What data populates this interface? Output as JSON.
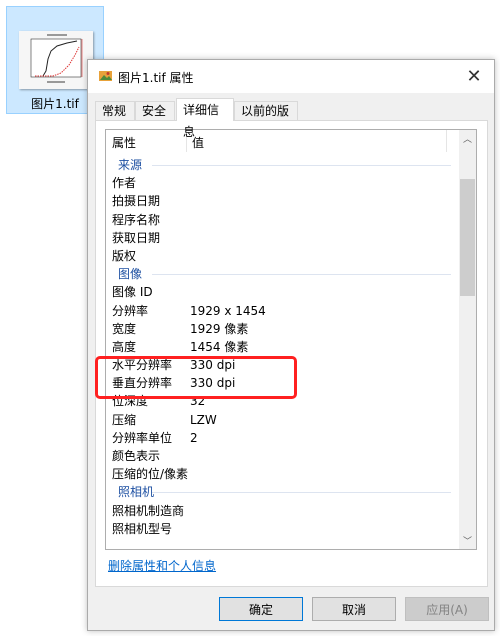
{
  "desktop": {
    "file_name": "图片1.tif"
  },
  "dialog": {
    "title": "图片1.tif 属性",
    "close_icon": "close-icon",
    "tabs": [
      {
        "label": "常规",
        "active": false
      },
      {
        "label": "安全",
        "active": false
      },
      {
        "label": "详细信息",
        "active": true
      },
      {
        "label": "以前的版本",
        "active": false
      }
    ],
    "list": {
      "header": {
        "property": "属性",
        "value": "值"
      },
      "rows": [
        {
          "type": "group",
          "key": "来源"
        },
        {
          "type": "item",
          "key": "作者",
          "value": ""
        },
        {
          "type": "item",
          "key": "拍摄日期",
          "value": ""
        },
        {
          "type": "item",
          "key": "程序名称",
          "value": ""
        },
        {
          "type": "item",
          "key": "获取日期",
          "value": ""
        },
        {
          "type": "item",
          "key": "版权",
          "value": ""
        },
        {
          "type": "group",
          "key": "图像"
        },
        {
          "type": "item",
          "key": "图像 ID",
          "value": ""
        },
        {
          "type": "item",
          "key": "分辨率",
          "value": "1929 x 1454"
        },
        {
          "type": "item",
          "key": "宽度",
          "value": "1929 像素"
        },
        {
          "type": "item",
          "key": "高度",
          "value": "1454 像素"
        },
        {
          "type": "item",
          "key": "水平分辨率",
          "value": "330 dpi"
        },
        {
          "type": "item",
          "key": "垂直分辨率",
          "value": "330 dpi"
        },
        {
          "type": "item",
          "key": "位深度",
          "value": "32"
        },
        {
          "type": "item",
          "key": "压缩",
          "value": "LZW"
        },
        {
          "type": "item",
          "key": "分辨率单位",
          "value": "2"
        },
        {
          "type": "item",
          "key": "颜色表示",
          "value": ""
        },
        {
          "type": "item",
          "key": "压缩的位/像素",
          "value": ""
        },
        {
          "type": "group",
          "key": "照相机"
        },
        {
          "type": "item",
          "key": "照相机制造商",
          "value": ""
        },
        {
          "type": "item",
          "key": "照相机型号",
          "value": ""
        }
      ],
      "scroll_up_icon": "chevron-up-icon",
      "scroll_down_icon": "chevron-down-icon"
    },
    "remove_link": "删除属性和个人信息",
    "buttons": {
      "ok": "确定",
      "cancel": "取消",
      "apply": "应用(A)"
    }
  },
  "annotation": {
    "highlight_color": "#ff2020"
  },
  "colors": {
    "group_header": "#1e50a2",
    "link": "#0066cc",
    "selection_bg": "#cce8ff"
  }
}
